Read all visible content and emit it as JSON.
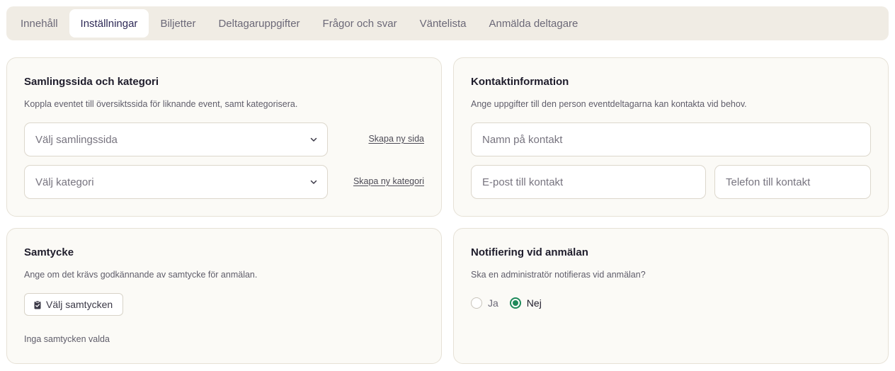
{
  "tabs": [
    {
      "label": "Innehåll"
    },
    {
      "label": "Inställningar",
      "active": true
    },
    {
      "label": "Biljetter"
    },
    {
      "label": "Deltagaruppgifter"
    },
    {
      "label": "Frågor och svar"
    },
    {
      "label": "Väntelista"
    },
    {
      "label": "Anmälda deltagare"
    }
  ],
  "collection": {
    "title": "Samlingssida och kategori",
    "description": "Koppla eventet till översiktssida för liknande event, samt kategorisera.",
    "page_select": "Välj samlingssida",
    "page_link": "Skapa ny sida",
    "category_select": "Välj kategori",
    "category_link": "Skapa ny kategori"
  },
  "contact": {
    "title": "Kontaktinformation",
    "description": "Ange uppgifter till den person eventdeltagarna kan kontakta vid behov.",
    "name_placeholder": "Namn på kontakt",
    "email_placeholder": "E-post till kontakt",
    "phone_placeholder": "Telefon till kontakt"
  },
  "consent": {
    "title": "Samtycke",
    "description": "Ange om det krävs godkännande av samtycke för anmälan.",
    "button_label": "Välj samtycken",
    "empty_text": "Inga samtycken valda"
  },
  "notification": {
    "title": "Notifiering vid anmälan",
    "description": "Ska en administratör notifieras vid anmälan?",
    "options": [
      {
        "label": "Ja",
        "checked": false
      },
      {
        "label": "Nej",
        "checked": true
      }
    ]
  },
  "colors": {
    "accent_green": "#1e8a5a",
    "tab_active_text": "#2f2a57",
    "card_bg": "#fbfaf6",
    "tabbar_bg": "#f0ece4"
  }
}
